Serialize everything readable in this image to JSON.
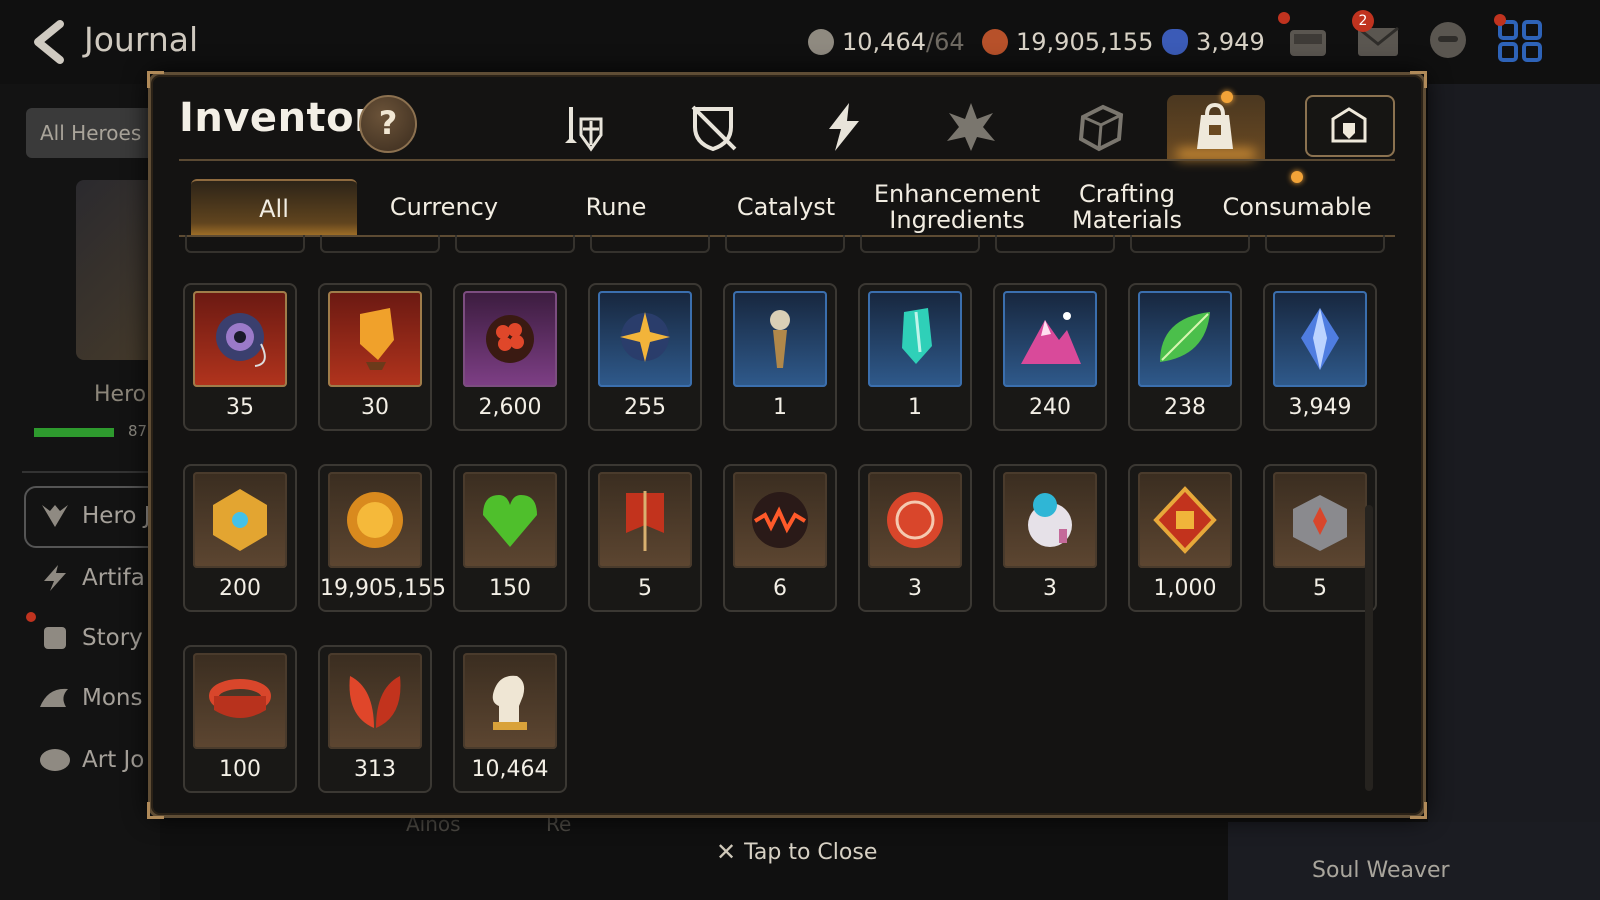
{
  "header": {
    "title": "Journal",
    "resources": [
      {
        "name": "stamina",
        "value": "10,464",
        "suffix": "/64",
        "icon": "stamina-icon",
        "color": "#8f8a80"
      },
      {
        "name": "gold",
        "value": "19,905,155",
        "icon": "gold-icon",
        "color": "#b7512a"
      },
      {
        "name": "skystone",
        "value": "3,949",
        "icon": "skystone-icon",
        "color": "#3b5bb7"
      }
    ],
    "mail_badge": "2"
  },
  "background": {
    "all_heroes": "All Heroes",
    "hero_label": "Hero",
    "hero_progress_text": "87",
    "menu": [
      "Hero J",
      "Artifa",
      "Story",
      "Mons",
      "Art Jo"
    ],
    "bottom_texts": [
      "Ainos",
      "Re"
    ],
    "soul_weaver": "Soul Weaver"
  },
  "inventory": {
    "title": "Inventory",
    "help": "?",
    "categories": [
      "equipment-icon",
      "rune-shield-icon",
      "artifact-icon",
      "imprint-icon",
      "box-icon",
      "bag-icon",
      "guild-icon"
    ],
    "active_category": "bag-icon",
    "tabs": [
      "All",
      "Currency",
      "Rune",
      "Catalyst",
      "Enhancement Ingredients",
      "Crafting Materials",
      "Consumable"
    ],
    "active_tab": "All",
    "items": [
      {
        "icon": "eye-ring-icon",
        "count": "35",
        "frame": "red"
      },
      {
        "icon": "crystal-shard-icon",
        "count": "30",
        "frame": "red"
      },
      {
        "icon": "flower-medallion-icon",
        "count": "2,600",
        "frame": "purple"
      },
      {
        "icon": "star-compass-icon",
        "count": "255",
        "frame": "blue"
      },
      {
        "icon": "pendulum-icon",
        "count": "1",
        "frame": "blue"
      },
      {
        "icon": "teal-crystal-icon",
        "count": "1",
        "frame": "blue"
      },
      {
        "icon": "pink-mountain-icon",
        "count": "240",
        "frame": "blue"
      },
      {
        "icon": "green-leaf-icon",
        "count": "238",
        "frame": "blue"
      },
      {
        "icon": "blue-gem-icon",
        "count": "3,949",
        "frame": "blue"
      },
      {
        "icon": "golden-emblem-icon",
        "count": "200",
        "frame": "brown"
      },
      {
        "icon": "gold-coin-icon",
        "count": "19,905,155",
        "frame": "brown"
      },
      {
        "icon": "green-heart-icon",
        "count": "150",
        "frame": "brown"
      },
      {
        "icon": "war-banner-icon",
        "count": "5",
        "frame": "brown"
      },
      {
        "icon": "fire-orb-icon",
        "count": "6",
        "frame": "brown"
      },
      {
        "icon": "red-seal-icon",
        "count": "3",
        "frame": "brown"
      },
      {
        "icon": "robot-pet-icon",
        "count": "3",
        "frame": "brown"
      },
      {
        "icon": "fist-badge-icon",
        "count": "1,000",
        "frame": "brown"
      },
      {
        "icon": "stone-crate-icon",
        "count": "5",
        "frame": "brown"
      },
      {
        "icon": "red-ring-icon",
        "count": "100",
        "frame": "brown"
      },
      {
        "icon": "red-leaves-icon",
        "count": "313",
        "frame": "brown"
      },
      {
        "icon": "horse-chess-icon",
        "count": "10,464",
        "frame": "brown"
      }
    ]
  },
  "footer": {
    "close_label": "Tap to Close"
  }
}
